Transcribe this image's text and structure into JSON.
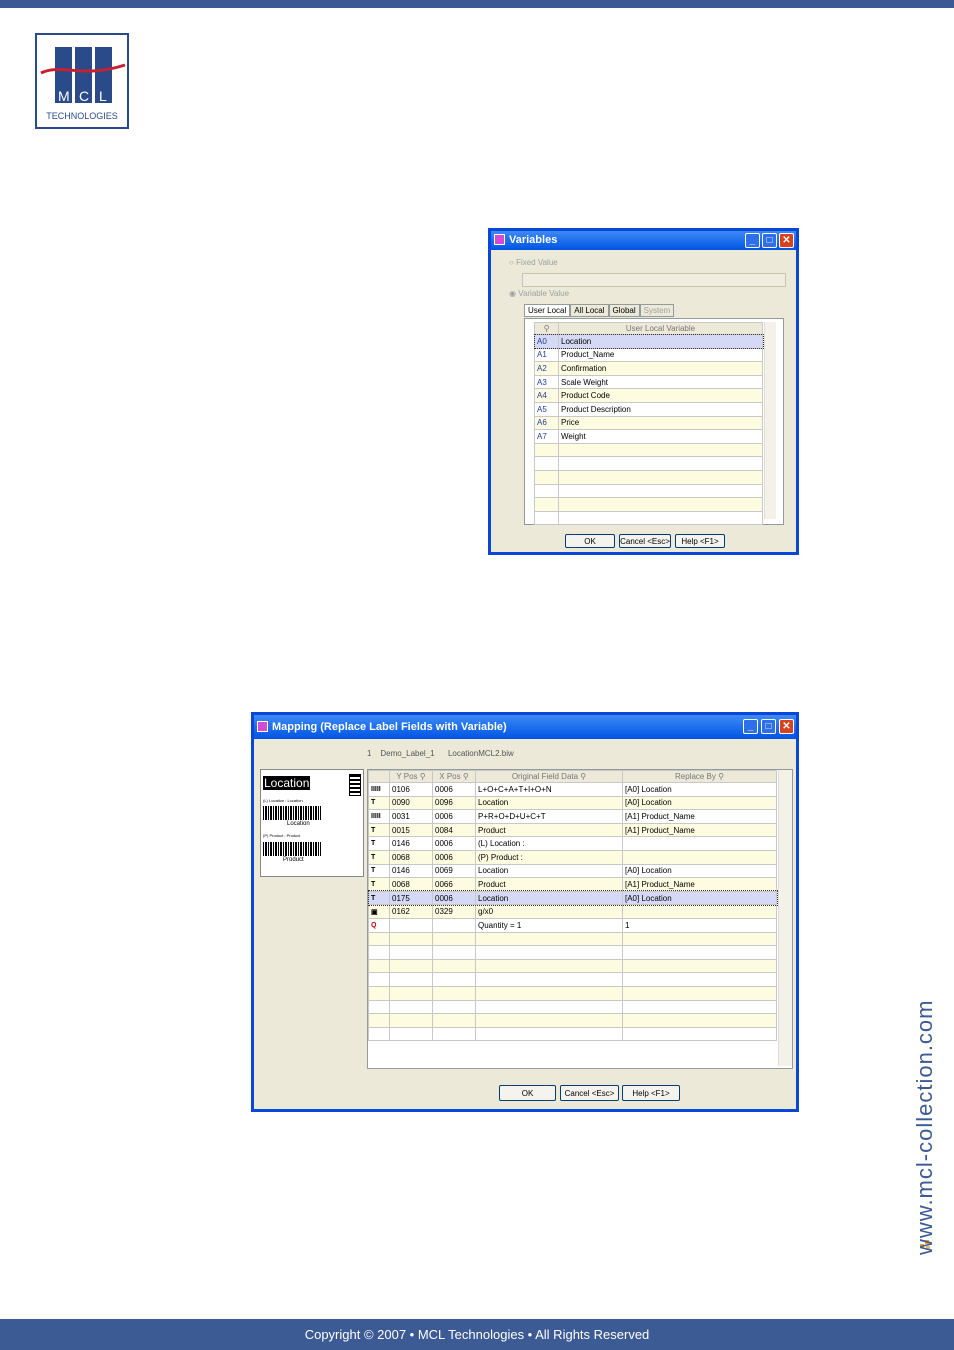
{
  "logo": {
    "letters": "MCL",
    "sub": "TECHNOLOGIES"
  },
  "footer": {
    "text": "Copyright © 2007 • MCL Technologies • All Rights Reserved"
  },
  "side_url": "www.mcl-collection.com",
  "variables_dialog": {
    "title": "Variables",
    "fixed_value_label": "Fixed Value",
    "variable_value_label": "Variable Value",
    "tabs": [
      "User Local",
      "All Local",
      "Global",
      "System"
    ],
    "column_header": "User Local Variable",
    "rows": [
      {
        "code": "A0",
        "name": "Location"
      },
      {
        "code": "A1",
        "name": "Product_Name"
      },
      {
        "code": "A2",
        "name": "Confirmation"
      },
      {
        "code": "A3",
        "name": "Scale Weight"
      },
      {
        "code": "A4",
        "name": "Product Code"
      },
      {
        "code": "A5",
        "name": "Product Description"
      },
      {
        "code": "A6",
        "name": "Price"
      },
      {
        "code": "A7",
        "name": "Weight"
      }
    ],
    "buttons": {
      "ok": "OK",
      "cancel": "Cancel <Esc>",
      "help": "Help <F1>"
    }
  },
  "mapping_dialog": {
    "title": "Mapping (Replace Label Fields with Variable)",
    "info": {
      "num": "1",
      "label": "Demo_Label_1",
      "file": "LocationMCL2.biw"
    },
    "headers": [
      "Y Pos",
      "X Pos",
      "Original Field Data",
      "Replace By"
    ],
    "preview": {
      "location": "Location",
      "small1": "(L) Location : Location",
      "location2": "Location",
      "small2": "(P) Product : Product",
      "product": "Product"
    },
    "rows": [
      {
        "icon": "IIIII",
        "y": "0106",
        "x": "0006",
        "data": "L+O+C+A+T+I+O+N",
        "repl": "[A0] Location"
      },
      {
        "icon": "T",
        "y": "0090",
        "x": "0096",
        "data": "Location",
        "repl": "[A0] Location"
      },
      {
        "icon": "IIIII",
        "y": "0031",
        "x": "0006",
        "data": "P+R+O+D+U+C+T",
        "repl": "[A1] Product_Name"
      },
      {
        "icon": "T",
        "y": "0015",
        "x": "0084",
        "data": "Product",
        "repl": "[A1] Product_Name"
      },
      {
        "icon": "T",
        "y": "0146",
        "x": "0006",
        "data": "(L) Location :",
        "repl": ""
      },
      {
        "icon": "T",
        "y": "0068",
        "x": "0006",
        "data": "(P) Product :",
        "repl": ""
      },
      {
        "icon": "T",
        "y": "0146",
        "x": "0069",
        "data": "Location",
        "repl": "[A0] Location"
      },
      {
        "icon": "T",
        "y": "0068",
        "x": "0066",
        "data": "Product",
        "repl": "[A1] Product_Name"
      },
      {
        "icon": "T",
        "y": "0175",
        "x": "0006",
        "data": "Location",
        "repl": "[A0] Location"
      },
      {
        "icon": "▣",
        "y": "0162",
        "x": "0329",
        "data": "g/x0",
        "repl": ""
      },
      {
        "icon": "Q",
        "y": "",
        "x": "",
        "data": "Quantity =  1",
        "repl": "1"
      }
    ],
    "buttons": {
      "ok": "OK",
      "cancel": "Cancel <Esc>",
      "help": "Help <F1>"
    }
  }
}
